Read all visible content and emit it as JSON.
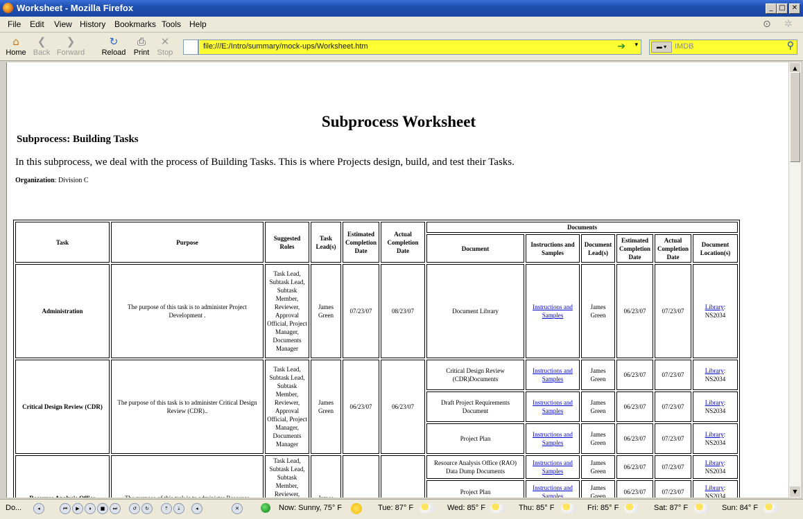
{
  "window": {
    "title": "Worksheet - Mozilla Firefox"
  },
  "menu": [
    "File",
    "Edit",
    "View",
    "History",
    "Bookmarks",
    "Tools",
    "Help"
  ],
  "toolbar": {
    "home": "Home",
    "back": "Back",
    "forward": "Forward",
    "reload": "Reload",
    "print": "Print",
    "stop": "Stop"
  },
  "url": "file:///E:/Intro/summary/mock-ups/Worksheet.htm",
  "search": {
    "placeholder": "IMDB"
  },
  "page": {
    "title": "Subprocess Worksheet",
    "subprocess": "Subprocess: Building Tasks",
    "intro": "In this subprocess, we deal with the process of Building Tasks. This is where Projects design, build, and test their Tasks.",
    "org_label": "Organization",
    "org_value": ": Division C"
  },
  "table": {
    "headers": {
      "task": "Task",
      "purpose": "Purpose",
      "roles": "Suggested Roles",
      "lead": "Task Lead(s)",
      "est": "Estimated Completion Date",
      "act": "Actual Completion Date",
      "documents": "Documents",
      "document": "Document",
      "instructions": "Instructions and Samples",
      "doclead": "Document Lead(s)",
      "docest": "Estimated Completion Date",
      "docact": "Actual Completion Date",
      "location": "Document Location(s)"
    },
    "rows": [
      {
        "task": "Administration",
        "purpose": "The purpose of this task is to administer Project Development .",
        "roles": "Task Lead, Subtask Lead, Subtask Member, Reviewer, Approval Official, Project Manager, Documents Manager",
        "lead": "James Green",
        "est": "07/23/07",
        "act": "08/23/07",
        "docs": [
          {
            "name": "Document Library",
            "instr": "Instructions and Samples",
            "lead": "James Green",
            "est": "06/23/07",
            "act": "07/23/07",
            "loc_link": "Library",
            "loc_text": ": NS2034"
          }
        ]
      },
      {
        "task": "Critical Design Review (CDR)",
        "purpose": "The purpose of this task is to administer Critical Design Review (CDR)..",
        "roles": "Task Lead, Subtask Lead, Subtask Member, Reviewer, Approval Official, Project Manager, Documents Manager",
        "lead": "James Green",
        "est": "06/23/07",
        "act": "06/23/07",
        "docs": [
          {
            "name": "Critical Design Review (CDR)Documents",
            "instr": "Instructions and Samples",
            "lead": "James Green",
            "est": "06/23/07",
            "act": "07/23/07",
            "loc_link": "Library",
            "loc_text": ": NS2034"
          },
          {
            "name": "Draft Project Requirements Document",
            "instr": "Instructions and Samples",
            "lead": "James Green",
            "est": "06/23/07",
            "act": "07/23/07",
            "loc_link": "Library",
            "loc_text": ": NS2034"
          },
          {
            "name": "Project Plan",
            "instr": "Instructions and Samples",
            "lead": "James Green",
            "est": "06/23/07",
            "act": "07/23/07",
            "loc_link": "Library",
            "loc_text": ": NS2034"
          }
        ]
      },
      {
        "task": "Resource Analysis Office",
        "purpose": "The purpose of this task is to administer Resource",
        "roles": "Task Lead, Subtask Lead, Subtask Member, Reviewer,",
        "lead": "James",
        "docs": [
          {
            "name": "Resource Analysis Office (RAO) Data Dump Documents",
            "instr": "Instructions and Samples",
            "lead": "James Green",
            "est": "06/23/07",
            "act": "07/23/07",
            "loc_link": "Library",
            "loc_text": ": NS2034"
          },
          {
            "name": "Project Plan",
            "instr": "Instructions and Samples",
            "lead": "James Green",
            "est": "06/23/07",
            "act": "07/23/07",
            "loc_link": "Library",
            "loc_text": ": NS2034"
          }
        ]
      }
    ]
  },
  "status": {
    "left": "Do...",
    "now": "Now: Sunny, 75° F",
    "forecast": [
      "Tue: 87° F",
      "Wed: 85° F",
      "Thu: 85° F",
      "Fri: 85° F",
      "Sat: 87° F",
      "Sun: 84° F"
    ]
  }
}
